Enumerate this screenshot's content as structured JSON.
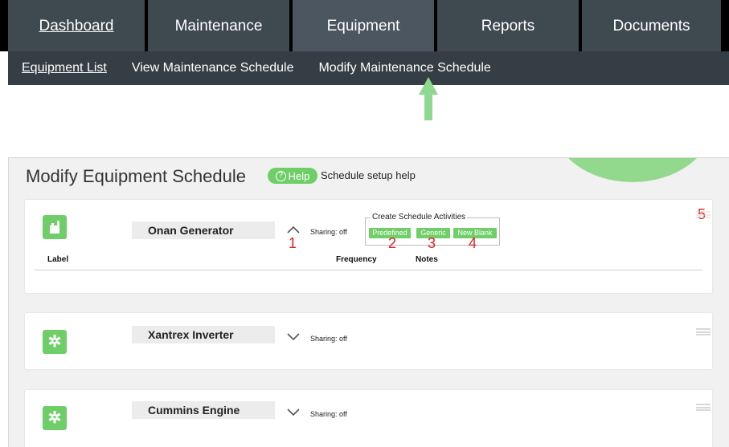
{
  "nav": {
    "tabs": [
      {
        "label": "Dashboard"
      },
      {
        "label": "Maintenance"
      },
      {
        "label": "Equipment"
      },
      {
        "label": "Reports"
      },
      {
        "label": "Documents"
      }
    ],
    "subnav": [
      {
        "label": "Equipment List"
      },
      {
        "label": "View Maintenance Schedule"
      },
      {
        "label": "Modify Maintenance Schedule"
      }
    ]
  },
  "page": {
    "title": "Modify Equipment Schedule",
    "help_label": "Help",
    "help_text": "Schedule setup help"
  },
  "cards": [
    {
      "name": "Onan Generator",
      "sharing": "Sharing: off"
    },
    {
      "name": "Xantrex Inverter",
      "sharing": "Sharing: off"
    },
    {
      "name": "Cummins Engine",
      "sharing": "Sharing: off"
    }
  ],
  "activities": {
    "legend": "Create Schedule Activities",
    "buttons": [
      "Predefined",
      "Generic",
      "New Blank"
    ]
  },
  "columns": {
    "label": "Label",
    "frequency": "Frequency",
    "notes": "Notes"
  },
  "annotations": [
    "1",
    "2",
    "3",
    "4",
    "5"
  ],
  "colors": {
    "accent": "#6fce68",
    "annotation": "#e02020",
    "arrow": "#8fd88f",
    "nav": "#3f4a50"
  },
  "icons": {
    "generator": "generator-icon",
    "gear": "gear-icon",
    "menu": "drag-handle-icon"
  }
}
